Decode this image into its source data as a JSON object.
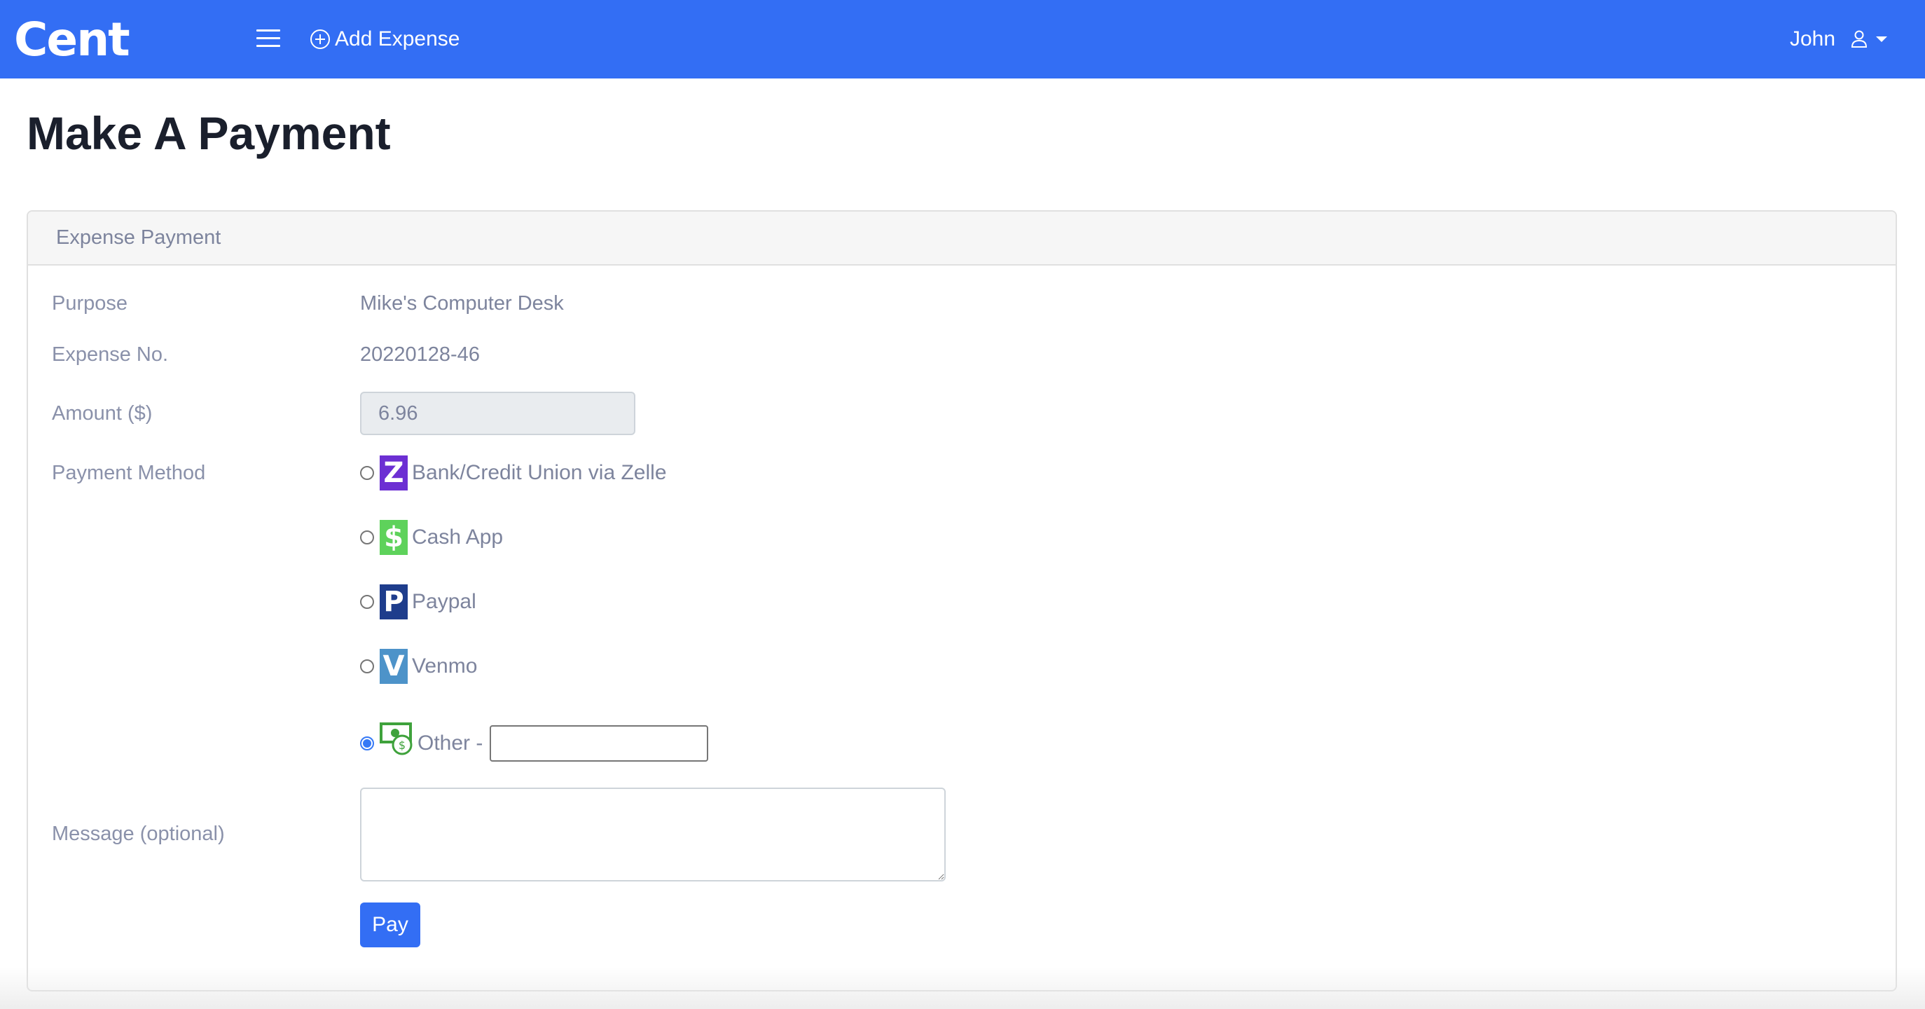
{
  "navbar": {
    "brand": "Cent",
    "menu_icon": "hamburger-menu-icon",
    "add_expense_label": "Add Expense",
    "add_expense_icon": "plus-circle-icon",
    "user_name": "John",
    "user_icon": "person-icon",
    "dropdown_icon": "caret-down-icon",
    "brand_color": "#336ef4"
  },
  "page": {
    "title": "Make A Payment"
  },
  "card": {
    "header": "Expense Payment",
    "fields": {
      "purpose_label": "Purpose",
      "purpose_value": "Mike's Computer Desk",
      "expense_no_label": "Expense No.",
      "expense_no_value": "20220128-46",
      "amount_label": "Amount ($)",
      "amount_value": "6.96",
      "payment_method_label": "Payment Method",
      "message_label": "Message (optional)",
      "message_value": ""
    },
    "payment_methods": [
      {
        "label": "Bank/Credit Union via Zelle",
        "icon": "zelle-icon",
        "glyph": "Z",
        "selected": false
      },
      {
        "label": "Cash App",
        "icon": "cashapp-icon",
        "glyph": "$",
        "selected": false
      },
      {
        "label": "Paypal",
        "icon": "paypal-icon",
        "glyph": "P",
        "selected": false
      },
      {
        "label": "Venmo",
        "icon": "venmo-icon",
        "glyph": "V",
        "selected": false
      },
      {
        "label": "Other -",
        "icon": "money-icon",
        "glyph": "",
        "selected": true,
        "other_value": ""
      }
    ],
    "pay_label": "Pay"
  }
}
